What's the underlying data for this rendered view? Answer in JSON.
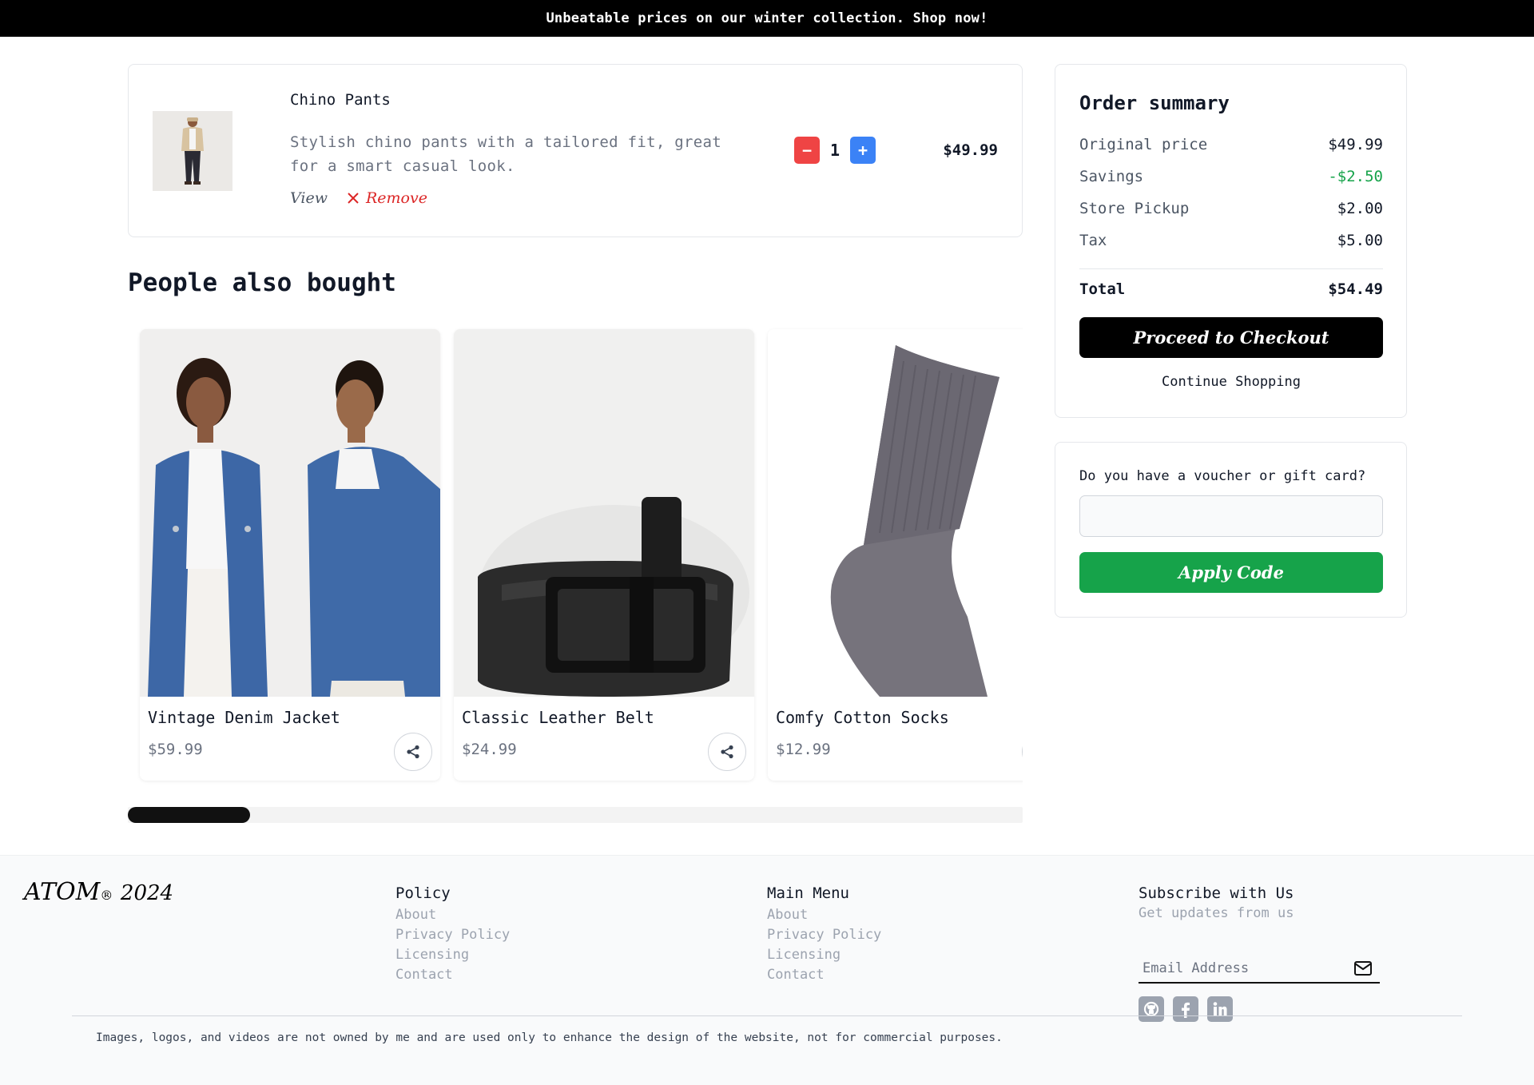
{
  "banner": {
    "text": "Unbeatable prices on our winter collection. Shop now!"
  },
  "cart": {
    "item": {
      "name": "Chino Pants",
      "description": "Stylish chino pants with a tailored fit, great for a smart casual look.",
      "view_label": "View",
      "remove_label": "Remove",
      "quantity": "1",
      "minus_label": "−",
      "plus_label": "+",
      "price": "$49.99"
    }
  },
  "recommendations": {
    "title": "People also bought",
    "products": [
      {
        "name": "Vintage Denim Jacket",
        "price": "$59.99"
      },
      {
        "name": "Classic Leather Belt",
        "price": "$24.99"
      },
      {
        "name": "Comfy Cotton Socks",
        "price": "$12.99"
      }
    ]
  },
  "summary": {
    "title": "Order summary",
    "rows": [
      {
        "label": "Original price",
        "value": "$49.99"
      },
      {
        "label": "Savings",
        "value": "-$2.50"
      },
      {
        "label": "Store Pickup",
        "value": "$2.00"
      },
      {
        "label": "Tax",
        "value": "$5.00"
      }
    ],
    "total_label": "Total",
    "total_value": "$54.49",
    "checkout_label": "Proceed to Checkout",
    "continue_label": "Continue Shopping",
    "savings_color": "#16a34a"
  },
  "voucher": {
    "label": "Do you have a voucher or gift card?",
    "input_value": "",
    "apply_label": "Apply Code",
    "apply_color": "#16a34a"
  },
  "footer": {
    "logo": "ATOM",
    "logo_mark": "®",
    "year": "2024",
    "policy": {
      "title": "Policy",
      "links": [
        "About",
        "Privacy Policy",
        "Licensing",
        "Contact"
      ]
    },
    "main_menu": {
      "title": "Main Menu",
      "links": [
        "About",
        "Privacy Policy",
        "Licensing",
        "Contact"
      ]
    },
    "subscribe": {
      "title": "Subscribe with Us",
      "subtitle": "Get updates from us",
      "email_placeholder": "Email Address"
    },
    "socials": [
      "github-icon",
      "facebook-icon",
      "linkedin-icon"
    ],
    "disclaimer": "Images, logos, and videos are not owned by me and are used only to enhance the design of the website, not for commercial purposes."
  }
}
